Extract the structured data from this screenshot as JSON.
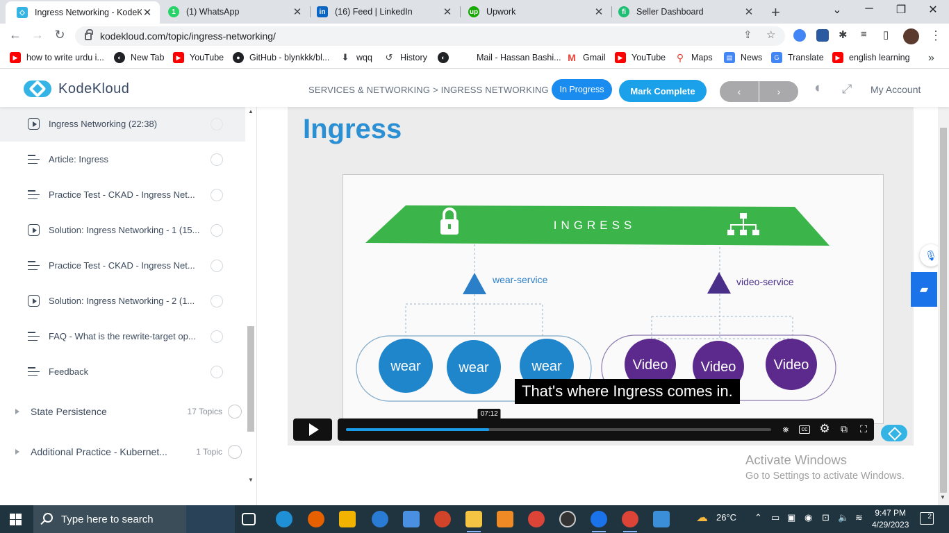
{
  "browser": {
    "tabs": [
      {
        "title": "Ingress Networking - KodeKl",
        "icon": "kodekloud-favicon",
        "color": "#34b4e4",
        "active": true
      },
      {
        "title": "(1) WhatsApp",
        "icon": "whatsapp-favicon",
        "color": "#25d366",
        "active": false
      },
      {
        "title": "(16) Feed | LinkedIn",
        "icon": "linkedin-favicon",
        "color": "#0a66c2",
        "active": false
      },
      {
        "title": "Upwork",
        "icon": "upwork-favicon",
        "color": "#14a800",
        "active": false
      },
      {
        "title": "Seller Dashboard",
        "icon": "fiverr-favicon",
        "color": "#1dbf73",
        "active": false
      }
    ],
    "url": "kodekloud.com/topic/ingress-networking/",
    "bookmarks": [
      {
        "label": "how to write urdu i...",
        "icon": "youtube-icon",
        "color": "#ff0000"
      },
      {
        "label": "New Tab",
        "icon": "globe-icon",
        "color": "#202124"
      },
      {
        "label": "YouTube",
        "icon": "youtube-icon",
        "color": "#ff0000"
      },
      {
        "label": "GitHub - blynkkk/bl...",
        "icon": "github-icon",
        "color": "#202124"
      },
      {
        "label": "wqq",
        "icon": "download-icon",
        "color": "#5f6368"
      },
      {
        "label": "History",
        "icon": "history-icon",
        "color": "#5f6368"
      },
      {
        "label": "",
        "icon": "globe-icon",
        "color": "#202124"
      },
      {
        "label": "Mail - Hassan Bashi...",
        "icon": "microsoft-icon",
        "color": "#f25022"
      },
      {
        "label": "Gmail",
        "icon": "gmail-icon",
        "color": "#ea4335"
      },
      {
        "label": "YouTube",
        "icon": "youtube-icon",
        "color": "#ff0000"
      },
      {
        "label": "Maps",
        "icon": "maps-icon",
        "color": "#34a853"
      },
      {
        "label": "News",
        "icon": "news-icon",
        "color": "#4285f4"
      },
      {
        "label": "Translate",
        "icon": "translate-icon",
        "color": "#4285f4"
      },
      {
        "label": "english learning",
        "icon": "youtube-icon",
        "color": "#ff0000"
      }
    ]
  },
  "header": {
    "brand": "KodeKloud",
    "breadcrumb": "SERVICES & NETWORKING > INGRESS NETWORKING",
    "status_label": "In Progress",
    "complete_label": "Mark Complete",
    "account_label": "My Account",
    "prev_glyph": "‹",
    "next_glyph": "›"
  },
  "sidebar": {
    "lessons": [
      {
        "title": "Ingress Networking (22:38)",
        "type": "video",
        "active": true
      },
      {
        "title": "Article: Ingress",
        "type": "article",
        "active": false
      },
      {
        "title": "Practice Test - CKAD - Ingress Net...",
        "type": "article",
        "active": false
      },
      {
        "title": "Solution: Ingress Networking - 1 (15...",
        "type": "video",
        "active": false
      },
      {
        "title": "Practice Test - CKAD - Ingress Net...",
        "type": "article",
        "active": false
      },
      {
        "title": "Solution: Ingress Networking - 2 (1...",
        "type": "video",
        "active": false
      },
      {
        "title": "FAQ - What is the rewrite-target op...",
        "type": "article",
        "active": false
      },
      {
        "title": "Feedback",
        "type": "article",
        "active": false
      }
    ],
    "sections": [
      {
        "title": "State Persistence",
        "count": "17 Topics"
      },
      {
        "title": "Additional Practice - Kubernet...",
        "count": "1 Topic"
      }
    ]
  },
  "video": {
    "slide_title": "Ingress",
    "ingress_label": "INGRESS",
    "services": [
      {
        "name": "wear-service",
        "color": "#2b7fc8",
        "pods": [
          "wear",
          "wear",
          "wear"
        ]
      },
      {
        "name": "video-service",
        "color": "#4a2f8a",
        "pods": [
          "Video",
          "Video",
          "Video"
        ]
      }
    ],
    "caption": "That's where Ingress comes in.",
    "current_time": "07:12",
    "progress": 0.337
  },
  "watermark": {
    "line1": "Activate Windows",
    "line2": "Go to Settings to activate Windows."
  },
  "taskbar": {
    "search_placeholder": "Type here to search",
    "weather": "26°C",
    "time": "9:47 PM",
    "date": "4/29/2023",
    "notifications": "2"
  }
}
